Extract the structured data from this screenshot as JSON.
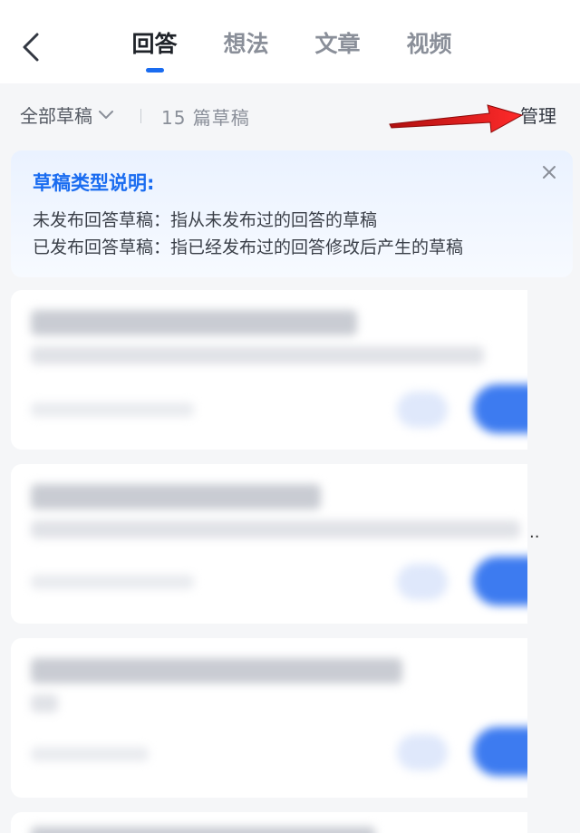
{
  "header": {
    "tabs": [
      {
        "label": "回答",
        "active": true
      },
      {
        "label": "想法",
        "active": false
      },
      {
        "label": "文章",
        "active": false
      },
      {
        "label": "视频",
        "active": false
      }
    ]
  },
  "filter": {
    "scope_label": "全部草稿",
    "count_label": "15 篇草稿",
    "manage_label": "管理"
  },
  "info_card": {
    "title": "草稿类型说明:",
    "lines": [
      "未发布回答草稿：指从未发布过的回答的草稿",
      "已发布回答草稿：指已经发布过的回答修改后产生的草稿"
    ]
  },
  "colors": {
    "accent": "#1a6cf0",
    "annotation_arrow": "#e02020"
  },
  "icons": {
    "back": "chevron-left-icon",
    "dropdown": "chevron-down-icon",
    "close": "close-icon",
    "annotation": "red-arrow-icon"
  }
}
